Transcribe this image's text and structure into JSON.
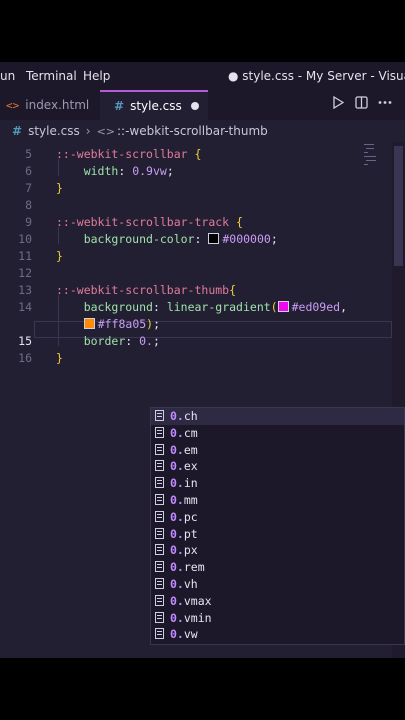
{
  "menubar": {
    "items": [
      "un",
      "Terminal",
      "Help"
    ],
    "title": "● style.css - My Server - Visual Studio"
  },
  "tabs": [
    {
      "icon": "<>",
      "label": "index.html",
      "active": false
    },
    {
      "icon": "#",
      "label": "style.css",
      "active": true,
      "modified": true
    }
  ],
  "breadcrumb": {
    "file": "style.css",
    "symbol": "::-webkit-scrollbar-thumb"
  },
  "editor": {
    "lines": [
      {
        "n": "5",
        "parts": [
          [
            "sel",
            "::-webkit-scrollbar "
          ],
          [
            "brace",
            "{"
          ]
        ]
      },
      {
        "n": "6",
        "parts": [
          [
            "plain",
            "    "
          ],
          [
            "prop",
            "width"
          ],
          [
            "plain",
            ": "
          ],
          [
            "val",
            "0.9vw"
          ],
          [
            "plain",
            ";"
          ]
        ]
      },
      {
        "n": "7",
        "parts": [
          [
            "brace",
            "}"
          ]
        ]
      },
      {
        "n": "8",
        "parts": []
      },
      {
        "n": "9",
        "parts": [
          [
            "sel",
            "::-webkit-scrollbar-track "
          ],
          [
            "brace",
            "{"
          ]
        ]
      },
      {
        "n": "10",
        "parts": [
          [
            "plain",
            "    "
          ],
          [
            "prop",
            "background-color"
          ],
          [
            "plain",
            ": "
          ],
          [
            "swatch",
            "#000000"
          ],
          [
            "val",
            "#000000"
          ],
          [
            "plain",
            ";"
          ]
        ]
      },
      {
        "n": "11",
        "parts": [
          [
            "brace",
            "}"
          ]
        ]
      },
      {
        "n": "12",
        "parts": []
      },
      {
        "n": "13",
        "parts": [
          [
            "sel",
            "::-webkit-scrollbar-thumb"
          ],
          [
            "brace",
            "{"
          ]
        ]
      },
      {
        "n": "14",
        "parts": [
          [
            "plain",
            "    "
          ],
          [
            "prop",
            "background"
          ],
          [
            "plain",
            ": "
          ],
          [
            "fn",
            "linear-gradient"
          ],
          [
            "brace",
            "("
          ],
          [
            "swatch",
            "#ed09ed"
          ],
          [
            "val",
            "#ed09ed"
          ],
          [
            "plain",
            ","
          ]
        ]
      },
      {
        "n": "",
        "parts": [
          [
            "plain",
            "    "
          ],
          [
            "swatch",
            "#ff8a05"
          ],
          [
            "val",
            "#ff8a05"
          ],
          [
            "brace",
            ")"
          ],
          [
            "plain",
            ";"
          ]
        ]
      },
      {
        "n": "15",
        "current": true,
        "parts": [
          [
            "plain",
            "    "
          ],
          [
            "prop",
            "border"
          ],
          [
            "plain",
            ": "
          ],
          [
            "val",
            "0."
          ],
          [
            "plain",
            ";"
          ]
        ]
      },
      {
        "n": "16",
        "parts": [
          [
            "brace",
            "}"
          ]
        ]
      }
    ]
  },
  "suggestions": {
    "prefix": "0.",
    "items": [
      "ch",
      "cm",
      "em",
      "ex",
      "in",
      "mm",
      "pc",
      "pt",
      "px",
      "rem",
      "vh",
      "vmax",
      "vmin",
      "vw"
    ]
  },
  "colors": {
    "accent": "#b45bd8",
    "background": "#231f33",
    "selector": "#e07b9a",
    "property": "#9ee2a8",
    "value": "#c99ef5",
    "brace": "#f2cf3c"
  }
}
